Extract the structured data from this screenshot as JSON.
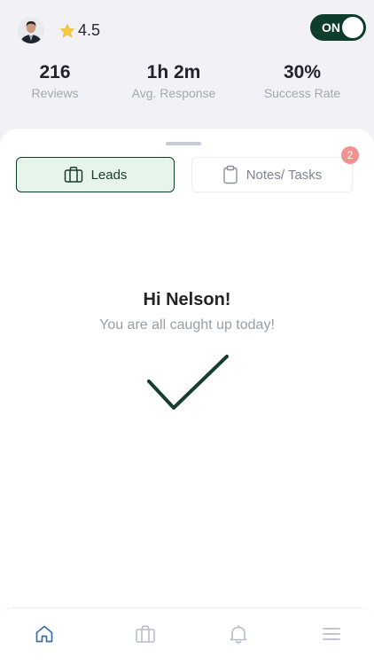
{
  "header": {
    "rating": "4.5",
    "toggle_label": "ON"
  },
  "stats": [
    {
      "value": "216",
      "label": "Reviews"
    },
    {
      "value": "1h 2m",
      "label": "Avg. Response"
    },
    {
      "value": "30%",
      "label": "Success Rate"
    }
  ],
  "tabs": {
    "leads": {
      "label": "Leads",
      "selected": true
    },
    "notes": {
      "label": "Notes/ Tasks",
      "badge": "2"
    }
  },
  "main": {
    "greeting": "Hi Nelson!",
    "subtitle": "You are all caught up today!"
  },
  "nav": {
    "items": [
      "home-icon",
      "briefcase-icon",
      "bell-icon",
      "menu-icon"
    ],
    "active": "home-icon"
  },
  "colors": {
    "accent": "#0f3d2c",
    "accent_light": "#e6f4ec",
    "badge": "#f39090",
    "nav_active": "#3b6fa3",
    "nav_inactive": "#b8bcc6"
  }
}
